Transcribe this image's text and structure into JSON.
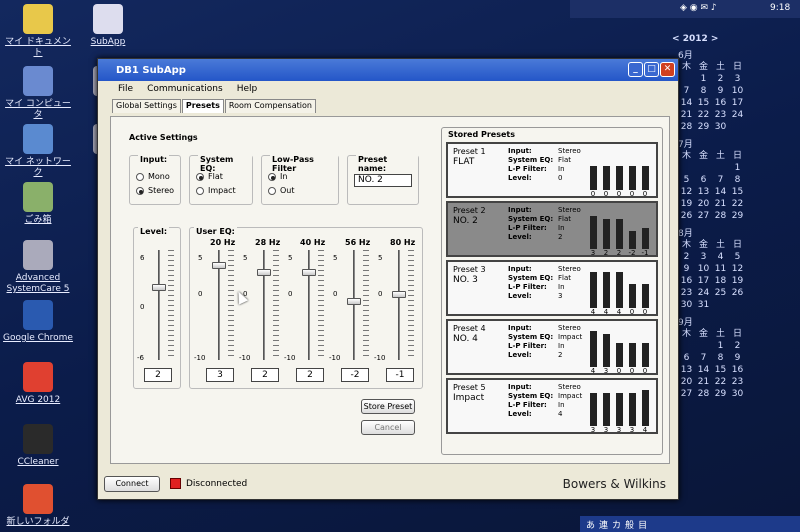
{
  "desktop": {
    "icons": [
      "マイ ドキュメント",
      "SubApp",
      "マイ コンピュータ",
      "Pic",
      "マイ ネットワーク",
      "Dro",
      "ごみ箱",
      "Advanced SystemCare 5",
      "Google Chrome",
      "AVG 2012",
      "CCleaner",
      "新しいフォルダ"
    ],
    "time": "9:18",
    "calendar": {
      "year": "2012",
      "weekdays": [
        "木",
        "金",
        "土",
        "日"
      ],
      "months": [
        {
          "name": "6月",
          "rows": [
            [
              "",
              "1",
              "2",
              "3"
            ],
            [
              "7",
              "8",
              "9",
              "10"
            ],
            [
              "14",
              "15",
              "16",
              "17"
            ],
            [
              "21",
              "22",
              "23",
              "24"
            ],
            [
              "28",
              "29",
              "30",
              ""
            ]
          ]
        },
        {
          "name": "7月",
          "rows": [
            [
              "",
              "",
              "",
              "1"
            ],
            [
              "5",
              "6",
              "7",
              "8"
            ],
            [
              "12",
              "13",
              "14",
              "15"
            ],
            [
              "19",
              "20",
              "21",
              "22"
            ],
            [
              "26",
              "27",
              "28",
              "29"
            ]
          ]
        },
        {
          "name": "8月",
          "rows": [
            [
              "2",
              "3",
              "4",
              "5"
            ],
            [
              "9",
              "10",
              "11",
              "12"
            ],
            [
              "16",
              "17",
              "18",
              "19"
            ],
            [
              "23",
              "24",
              "25",
              "26"
            ],
            [
              "30",
              "31",
              "",
              ""
            ]
          ]
        },
        {
          "name": "9月",
          "rows": [
            [
              "",
              "",
              "1",
              "2"
            ],
            [
              "6",
              "7",
              "8",
              "9"
            ],
            [
              "13",
              "14",
              "15",
              "16"
            ],
            [
              "20",
              "21",
              "22",
              "23"
            ],
            [
              "27",
              "28",
              "29",
              "30"
            ]
          ]
        }
      ]
    }
  },
  "window": {
    "title": "DB1 SubApp",
    "menu": [
      "File",
      "Communications",
      "Help"
    ],
    "tabs": [
      "Global Settings",
      "Presets",
      "Room Compensation"
    ],
    "active_settings": {
      "title": "Active Settings",
      "input": {
        "title": "Input:",
        "options": [
          "Mono",
          "Stereo"
        ],
        "selected": "Stereo"
      },
      "system_eq": {
        "title": "System EQ:",
        "options": [
          "Flat",
          "Impact"
        ],
        "selected": "Flat"
      },
      "lpf": {
        "title": "Low-Pass Filter",
        "options": [
          "In",
          "Out"
        ],
        "selected": "In"
      },
      "preset_name": {
        "title": "Preset name:",
        "value": "NO. 2"
      },
      "level": {
        "title": "Level:",
        "scale": [
          "6",
          "0",
          "-6"
        ],
        "value": "2",
        "num": 2,
        "min": -6,
        "max": 6
      },
      "user_eq": {
        "title": "User EQ:",
        "bands": [
          {
            "hz": "20 Hz",
            "value": "3",
            "num": 3
          },
          {
            "hz": "28 Hz",
            "value": "2",
            "num": 2
          },
          {
            "hz": "40 Hz",
            "value": "2",
            "num": 2
          },
          {
            "hz": "56 Hz",
            "value": "-2",
            "num": -2
          },
          {
            "hz": "80 Hz",
            "value": "-1",
            "num": -1
          }
        ],
        "scale": [
          "5",
          "0",
          "-10"
        ],
        "min": -10,
        "max": 5
      },
      "store_label": "Store Preset",
      "cancel_label": "Cancel"
    },
    "stored_presets": {
      "title": "Stored Presets",
      "field_labels": [
        "Input:",
        "System EQ:",
        "L-P Filter:",
        "Level:"
      ],
      "items": [
        {
          "label": "Preset 1",
          "name": "FLAT",
          "input": "Stereo",
          "eq": "Flat",
          "lpf": "In",
          "level": "0",
          "bars": [
            0,
            0,
            0,
            0,
            0
          ],
          "bar_labels": [
            "0",
            "0",
            "0",
            "0",
            "0"
          ],
          "selected": false
        },
        {
          "label": "Preset 2",
          "name": "NO. 2",
          "input": "Stereo",
          "eq": "Flat",
          "lpf": "In",
          "level": "2",
          "bars": [
            3,
            2,
            2,
            -2,
            -1
          ],
          "bar_labels": [
            "3",
            "2",
            "2",
            "-2",
            "-1"
          ],
          "selected": true
        },
        {
          "label": "Preset 3",
          "name": "NO. 3",
          "input": "Stereo",
          "eq": "Flat",
          "lpf": "In",
          "level": "3",
          "bars": [
            4,
            4,
            4,
            0,
            0
          ],
          "bar_labels": [
            "4",
            "4",
            "4",
            "0",
            "0"
          ],
          "selected": false
        },
        {
          "label": "Preset 4",
          "name": "NO. 4",
          "input": "Stereo",
          "eq": "Impact",
          "lpf": "In",
          "level": "2",
          "bars": [
            4,
            3,
            0,
            0,
            0
          ],
          "bar_labels": [
            "4",
            "3",
            "0",
            "0",
            "0"
          ],
          "selected": false
        },
        {
          "label": "Preset 5",
          "name": "Impact",
          "input": "Stereo",
          "eq": "Impact",
          "lpf": "In",
          "level": "4",
          "bars": [
            3,
            3,
            3,
            3,
            4
          ],
          "bar_labels": [
            "3",
            "3",
            "3",
            "3",
            "4"
          ],
          "selected": false
        }
      ]
    },
    "connect_label": "Connect",
    "status_text": "Disconnected",
    "status_color": "#e02020",
    "brand": "Bowers & Wilkins"
  },
  "taskbar": {
    "ime": [
      "あ",
      "連",
      "カ",
      "般",
      "目"
    ]
  }
}
